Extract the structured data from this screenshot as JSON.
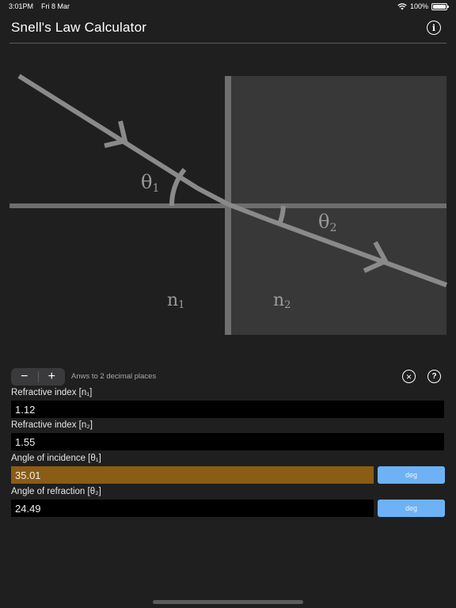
{
  "status_bar": {
    "time": "3:01PM",
    "date": "Fri 8 Mar",
    "battery": "100%"
  },
  "header": {
    "title": "Snell's Law Calculator",
    "info_icon": "info-circle-icon"
  },
  "diagram": {
    "theta1_label": "θ",
    "theta1_sub": "1",
    "theta2_label": "θ",
    "theta2_sub": "2",
    "n1_label": "n",
    "n1_sub": "1",
    "n2_label": "n",
    "n2_sub": "2",
    "colors": {
      "medium1": "#1f1f1f",
      "medium2": "#383838",
      "lines": "#8a8a8a"
    }
  },
  "toolbar": {
    "minus_label": "−",
    "plus_label": "+",
    "precision_text": "Anws to 2 decimal places",
    "clear_icon": "x-circle-icon",
    "help_icon": "question-circle-icon"
  },
  "fields": {
    "n1": {
      "label": "Refractive index [n₁]",
      "value": "1.12"
    },
    "n2": {
      "label": "Refractive index [n₂]",
      "value": "1.55"
    },
    "theta1": {
      "label": "Angle of incidence [θ₁]",
      "value": "35.01",
      "unit": "deg"
    },
    "theta2": {
      "label": "Angle of refraction [θ₂]",
      "value": "24.49",
      "unit": "deg"
    }
  },
  "colors": {
    "active_field": "#8a5c14",
    "unit_button": "#6eb2f5"
  }
}
